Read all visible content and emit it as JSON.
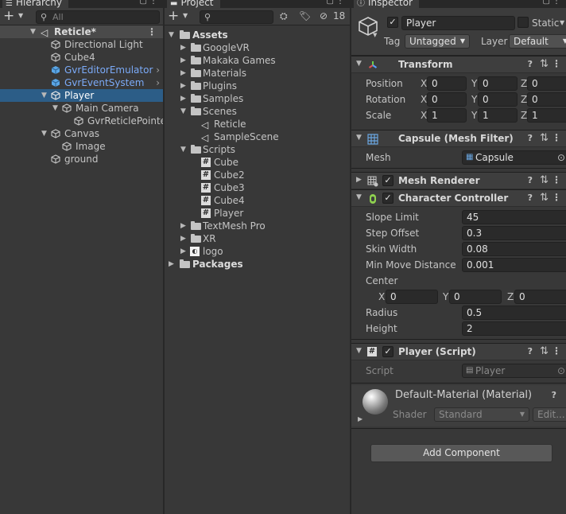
{
  "hierarchy": {
    "tab_label": "Hierarchy",
    "search_placeholder": "All",
    "items": [
      {
        "label": "Reticle*"
      },
      {
        "label": "Directional Light"
      },
      {
        "label": "Cube4"
      },
      {
        "label": "GvrEditorEmulator"
      },
      {
        "label": "GvrEventSystem"
      },
      {
        "label": "Player"
      },
      {
        "label": "Main Camera"
      },
      {
        "label": "GvrReticlePointer"
      },
      {
        "label": "Canvas"
      },
      {
        "label": "Image"
      },
      {
        "label": "ground"
      }
    ]
  },
  "project": {
    "tab_label": "Project",
    "hidden_count": "18",
    "items": [
      {
        "label": "Assets"
      },
      {
        "label": "GoogleVR"
      },
      {
        "label": "Makaka Games"
      },
      {
        "label": "Materials"
      },
      {
        "label": "Plugins"
      },
      {
        "label": "Samples"
      },
      {
        "label": "Scenes"
      },
      {
        "label": "Reticle"
      },
      {
        "label": "SampleScene"
      },
      {
        "label": "Scripts"
      },
      {
        "label": "Cube"
      },
      {
        "label": "Cube2"
      },
      {
        "label": "Cube3"
      },
      {
        "label": "Cube4"
      },
      {
        "label": "Player"
      },
      {
        "label": "TextMesh Pro"
      },
      {
        "label": "XR"
      },
      {
        "label": "logo"
      },
      {
        "label": "Packages"
      }
    ]
  },
  "inspector": {
    "tab_label": "Inspector",
    "object_name": "Player",
    "static_label": "Static",
    "tag_label": "Tag",
    "tag_value": "Untagged",
    "layer_label": "Layer",
    "layer_value": "Default",
    "transform": {
      "title": "Transform",
      "position_label": "Position",
      "rotation_label": "Rotation",
      "scale_label": "Scale",
      "axis_x": "X",
      "axis_y": "Y",
      "axis_z": "Z",
      "position": [
        "0",
        "0",
        "0"
      ],
      "rotation": [
        "0",
        "0",
        "0"
      ],
      "scale": [
        "1",
        "1",
        "1"
      ]
    },
    "mesh_filter": {
      "title": "Capsule (Mesh Filter)",
      "mesh_label": "Mesh",
      "mesh_value": "Capsule"
    },
    "mesh_renderer": {
      "title": "Mesh Renderer"
    },
    "character_controller": {
      "title": "Character Controller",
      "slope_limit_label": "Slope Limit",
      "slope_limit": "45",
      "step_offset_label": "Step Offset",
      "step_offset": "0.3",
      "skin_width_label": "Skin Width",
      "skin_width": "0.08",
      "min_move_label": "Min Move Distance",
      "min_move": "0.001",
      "center_label": "Center",
      "center": [
        "0",
        "0",
        "0"
      ],
      "radius_label": "Radius",
      "radius": "0.5",
      "height_label": "Height",
      "height": "2"
    },
    "player_script": {
      "title": "Player (Script)",
      "script_label": "Script",
      "script_value": "Player"
    },
    "material": {
      "title": "Default-Material (Material)",
      "shader_label": "Shader",
      "shader_value": "Standard",
      "edit_label": "Edit..."
    },
    "add_component": "Add Component"
  },
  "colors": {
    "selection": "#2c5d87",
    "prefab_blue": "#7baaf7",
    "panel_bg": "#383838"
  }
}
